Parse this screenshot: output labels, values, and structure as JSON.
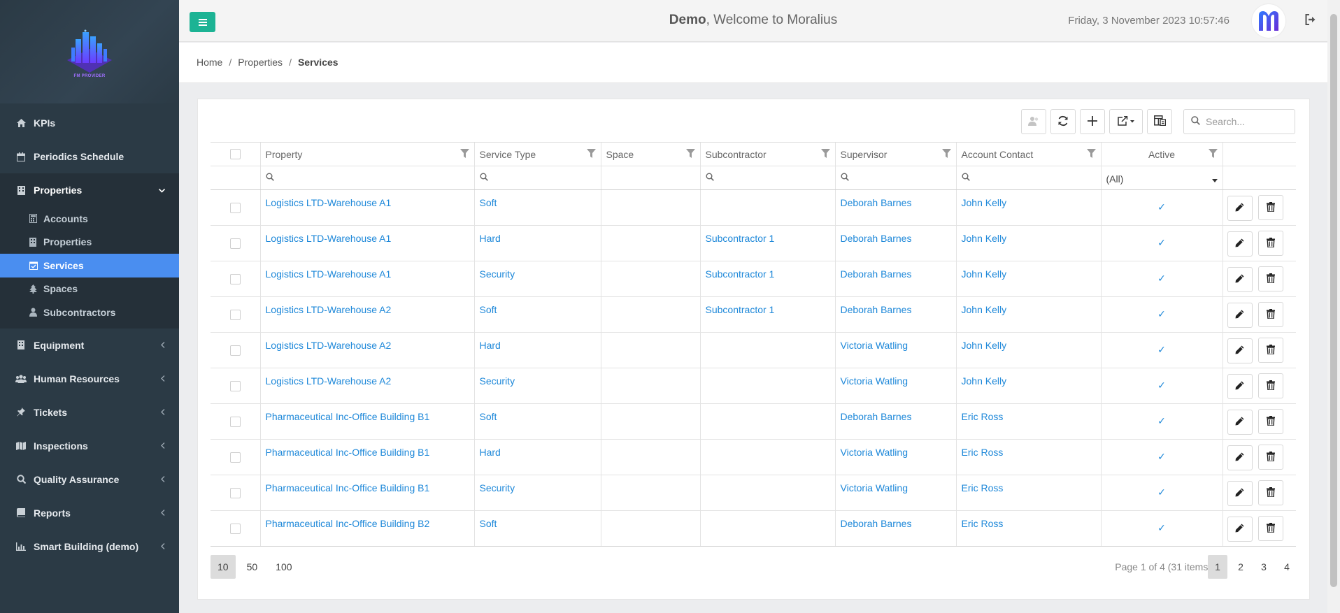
{
  "brand": {
    "caption": "FM PROVIDER"
  },
  "sidebar": {
    "items": [
      {
        "label": "KPIs",
        "icon": "home-icon"
      },
      {
        "label": "Periodics Schedule",
        "icon": "calendar-icon"
      },
      {
        "label": "Properties",
        "icon": "building-icon",
        "open": true,
        "children": [
          {
            "label": "Accounts",
            "icon": "calculator-icon"
          },
          {
            "label": "Properties",
            "icon": "building-icon"
          },
          {
            "label": "Services",
            "icon": "calendar-check-icon",
            "active": true
          },
          {
            "label": "Spaces",
            "icon": "tree-icon"
          },
          {
            "label": "Subcontractors",
            "icon": "user-tie-icon"
          }
        ]
      },
      {
        "label": "Equipment",
        "icon": "building-icon"
      },
      {
        "label": "Human Resources",
        "icon": "users-icon"
      },
      {
        "label": "Tickets",
        "icon": "thumbtack-icon"
      },
      {
        "label": "Inspections",
        "icon": "map-icon"
      },
      {
        "label": "Quality Assurance",
        "icon": "search-icon"
      },
      {
        "label": "Reports",
        "icon": "book-icon"
      },
      {
        "label": "Smart Building (demo)",
        "icon": "bar-chart-icon"
      }
    ]
  },
  "header": {
    "user": "Demo",
    "welcome_text": ", Welcome to Moralius",
    "datetime": "Friday, 3 November 2023 10:57:46"
  },
  "breadcrumb": {
    "home": "Home",
    "parent": "Properties",
    "current": "Services"
  },
  "search": {
    "placeholder": "Search..."
  },
  "grid": {
    "columns": [
      "Property",
      "Service Type",
      "Space",
      "Subcontractor",
      "Supervisor",
      "Account Contact",
      "Active"
    ],
    "active_filter": "(All)",
    "rows": [
      {
        "property": "Logistics LTD-Warehouse A1",
        "service_type": "Soft",
        "space": "",
        "subcontractor": "",
        "supervisor": "Deborah Barnes",
        "account_contact": "John Kelly",
        "active": "✓"
      },
      {
        "property": "Logistics LTD-Warehouse A1",
        "service_type": "Hard",
        "space": "",
        "subcontractor": "Subcontractor 1",
        "supervisor": "Deborah Barnes",
        "account_contact": "John Kelly",
        "active": "✓"
      },
      {
        "property": "Logistics LTD-Warehouse A1",
        "service_type": "Security",
        "space": "",
        "subcontractor": "Subcontractor 1",
        "supervisor": "Deborah Barnes",
        "account_contact": "John Kelly",
        "active": "✓"
      },
      {
        "property": "Logistics LTD-Warehouse A2",
        "service_type": "Soft",
        "space": "",
        "subcontractor": "Subcontractor 1",
        "supervisor": "Deborah Barnes",
        "account_contact": "John Kelly",
        "active": "✓"
      },
      {
        "property": "Logistics LTD-Warehouse A2",
        "service_type": "Hard",
        "space": "",
        "subcontractor": "",
        "supervisor": "Victoria Watling",
        "account_contact": "John Kelly",
        "active": "✓"
      },
      {
        "property": "Logistics LTD-Warehouse A2",
        "service_type": "Security",
        "space": "",
        "subcontractor": "",
        "supervisor": "Victoria Watling",
        "account_contact": "John Kelly",
        "active": "✓"
      },
      {
        "property": "Pharmaceutical Inc-Office Building B1",
        "service_type": "Soft",
        "space": "",
        "subcontractor": "",
        "supervisor": "Deborah Barnes",
        "account_contact": "Eric Ross",
        "active": "✓"
      },
      {
        "property": "Pharmaceutical Inc-Office Building B1",
        "service_type": "Hard",
        "space": "",
        "subcontractor": "",
        "supervisor": "Victoria Watling",
        "account_contact": "Eric Ross",
        "active": "✓"
      },
      {
        "property": "Pharmaceutical Inc-Office Building B1",
        "service_type": "Security",
        "space": "",
        "subcontractor": "",
        "supervisor": "Victoria Watling",
        "account_contact": "Eric Ross",
        "active": "✓"
      },
      {
        "property": "Pharmaceutical Inc-Office Building B2",
        "service_type": "Soft",
        "space": "",
        "subcontractor": "",
        "supervisor": "Deborah Barnes",
        "account_contact": "Eric Ross",
        "active": "✓"
      }
    ]
  },
  "pager": {
    "sizes": [
      "10",
      "50",
      "100"
    ],
    "current_size": "10",
    "info": "Page 1 of 4 (31 items)",
    "pages": [
      "1",
      "2",
      "3",
      "4"
    ],
    "current_page": "1"
  },
  "colors": {
    "sidebar": "#2b3a45",
    "accent": "#4a8ef0",
    "menu_button": "#1cb394",
    "link": "#1e88d9"
  }
}
